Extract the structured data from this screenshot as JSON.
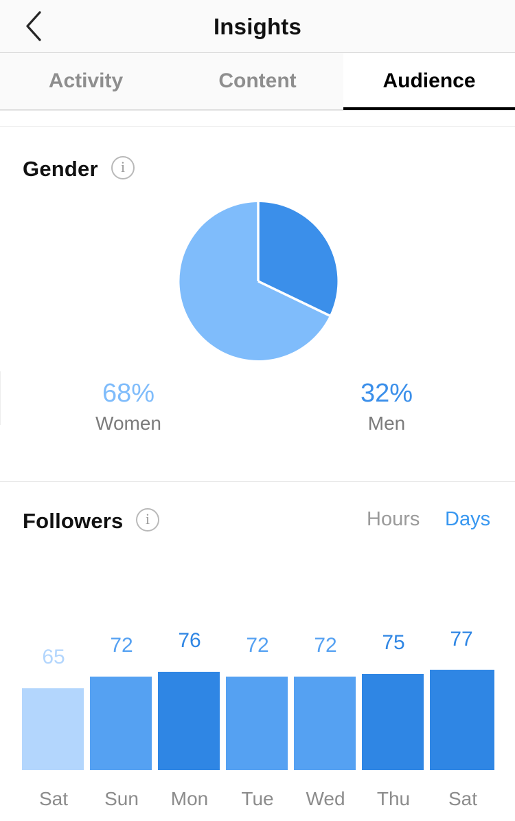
{
  "nav": {
    "title": "Insights",
    "back_icon": "chevron-left-icon"
  },
  "tabs": [
    {
      "label": "Activity",
      "active": false
    },
    {
      "label": "Content",
      "active": false
    },
    {
      "label": "Audience",
      "active": true
    }
  ],
  "gender": {
    "title": "Gender",
    "info_icon": "info-icon",
    "legend": [
      {
        "percent": "68%",
        "label": "Women",
        "color": "#7fbcfb"
      },
      {
        "percent": "32%",
        "label": "Men",
        "color": "#3b8fea"
      }
    ]
  },
  "followers": {
    "title": "Followers",
    "info_icon": "info-icon",
    "range_hours": "Hours",
    "range_days": "Days"
  },
  "colors": {
    "accent": "#3897f0",
    "pie_women": "#7fbcfb",
    "pie_men": "#3b8fea",
    "bar_light": "#b3d6fd",
    "bar_mid": "#55a1f2",
    "bar_dark": "#2f86e4",
    "text_muted": "#8c8c8c",
    "text_dark": "#111111"
  },
  "chart_data": [
    {
      "type": "pie",
      "title": "Gender",
      "labels": [
        "Men",
        "Women"
      ],
      "values": [
        32,
        68
      ],
      "value_labels": [
        "32%",
        "68%"
      ],
      "colors": [
        "#3b8fea",
        "#7fbcfb"
      ],
      "start_angle": 0,
      "direction": "clockwise",
      "legend": "bottom"
    },
    {
      "type": "bar",
      "title": "Followers",
      "categories": [
        "Sat",
        "Sun",
        "Mon",
        "Tue",
        "Wed",
        "Thu",
        "Sat"
      ],
      "values": [
        65,
        72,
        76,
        72,
        72,
        75,
        77
      ],
      "bar_colors": [
        "#b3d6fd",
        "#55a1f2",
        "#2f86e4",
        "#55a1f2",
        "#55a1f2",
        "#2f86e4",
        "#2f86e4"
      ],
      "label_colors": [
        "#b3d6fd",
        "#55a1f2",
        "#2f86e4",
        "#55a1f2",
        "#55a1f2",
        "#2f86e4",
        "#2f86e4"
      ],
      "xlabel": "",
      "ylabel": "",
      "ylim": [
        0,
        80
      ],
      "grid": false,
      "data_labels": true,
      "active_range": "Days"
    }
  ]
}
